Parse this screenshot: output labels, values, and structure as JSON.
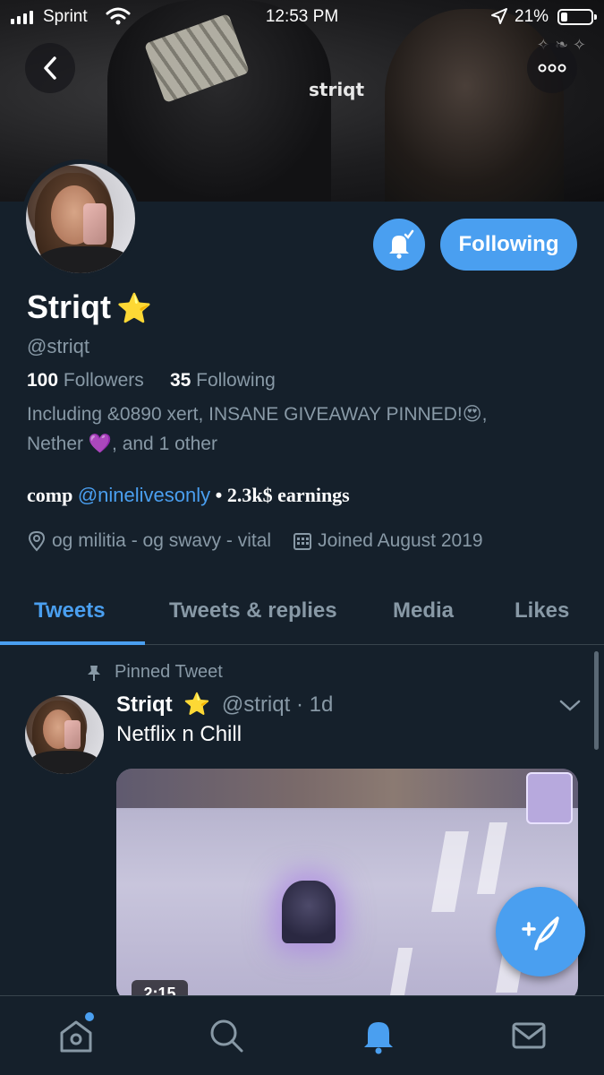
{
  "status_bar": {
    "carrier": "Sprint",
    "time": "12:53 PM",
    "battery": "21%"
  },
  "banner": {
    "wordmark": "striqt"
  },
  "profile": {
    "name": "Striqt",
    "star": "⭐",
    "handle": "@striqt",
    "followers_count": "100",
    "followers_label": "Followers",
    "following_count": "35",
    "following_label": "Following",
    "mutual_line1": "Including &0890 xert, INSANE GIVEAWAY PINNED!😍,",
    "mutual_line2_prefix": "Nether ",
    "mutual_heart": "💜",
    "mutual_line2_suffix": ", and 1 other",
    "bio_prefix": "comp ",
    "bio_mention": "@ninelivesonly",
    "bio_suffix": " • 2.3k$ earnings",
    "location": "og militia - og swavy - vital",
    "joined": "Joined August 2019",
    "follow_button": "Following"
  },
  "tabs": [
    {
      "label": "Tweets",
      "active": true
    },
    {
      "label": "Tweets & replies",
      "active": false
    },
    {
      "label": "Media",
      "active": false
    },
    {
      "label": "Likes",
      "active": false
    }
  ],
  "pinned_tweet": {
    "pinned_label": "Pinned Tweet",
    "author_name": "Striqt",
    "star": "⭐",
    "author_handle_time": "@striqt · 1d",
    "text": "Netflix n Chill",
    "video_duration": "2:15"
  },
  "colors": {
    "accent": "#4a9ff0",
    "background": "#15202b",
    "muted_text": "#8899a6",
    "divider": "#38444d"
  },
  "icons": {
    "back": "chevron-left-icon",
    "more": "more-dots-icon",
    "bell": "bell-check-icon",
    "location": "location-pin-icon",
    "calendar": "calendar-icon",
    "pin": "pin-icon",
    "chevron": "chevron-down-icon",
    "compose": "compose-feather-icon",
    "home": "home-icon",
    "search": "search-icon",
    "notifications": "notifications-bell-icon",
    "messages": "mail-icon"
  }
}
